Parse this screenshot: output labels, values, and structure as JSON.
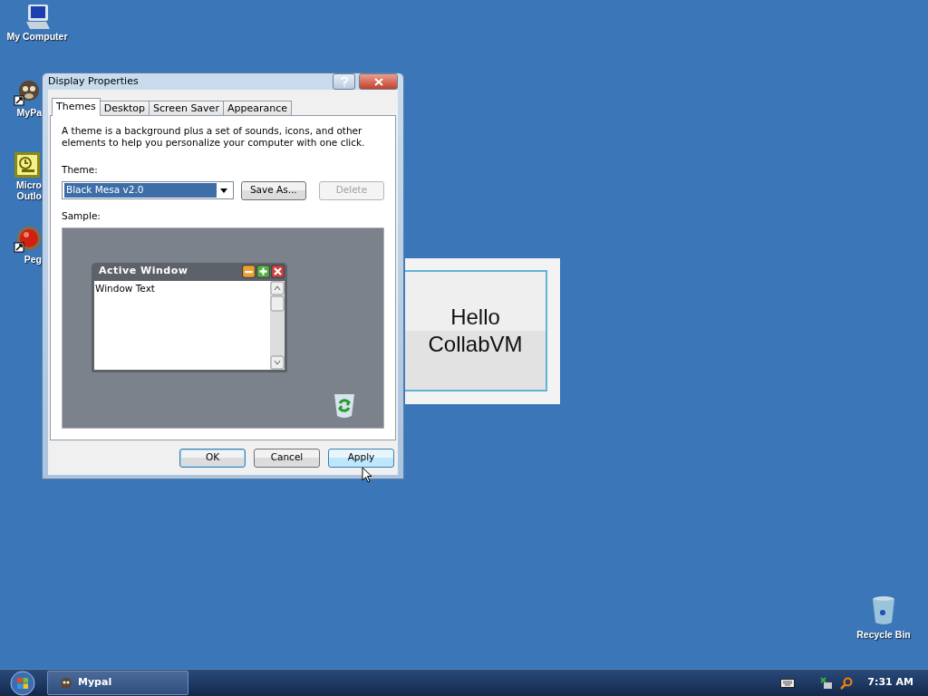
{
  "desktop_icons": [
    {
      "kind": "computer",
      "lines": [
        "My Computer"
      ]
    },
    {
      "kind": "app",
      "lines": [
        "MyPa"
      ]
    },
    {
      "kind": "mail",
      "lines": [
        "Micro",
        "Outlo"
      ]
    },
    {
      "kind": "game",
      "lines": [
        "Peg"
      ]
    }
  ],
  "recycle_bin": {
    "label": "Recycle Bin"
  },
  "hello_window": {
    "text": "Hello CollabVM"
  },
  "dialog": {
    "title": "Display Properties",
    "tabs": [
      {
        "label": "Themes",
        "selected": true
      },
      {
        "label": "Desktop",
        "selected": false
      },
      {
        "label": "Screen Saver",
        "selected": false
      },
      {
        "label": "Appearance",
        "selected": false
      }
    ],
    "description": "A theme is a background plus a set of sounds, icons, and other elements to help you personalize your computer with one click.",
    "theme_label": "Theme:",
    "theme_value": "Black Mesa v2.0",
    "theme_buttons": [
      {
        "label": "Save As...",
        "disabled": false
      },
      {
        "label": "Delete",
        "disabled": true
      }
    ],
    "sample_label": "Sample:",
    "sample": {
      "title": "Active Window",
      "body": "Window Text"
    },
    "footer_buttons": [
      {
        "label": "OK",
        "default": true,
        "hover": false
      },
      {
        "label": "Cancel",
        "default": false,
        "hover": false
      },
      {
        "label": "Apply",
        "default": false,
        "hover": true
      }
    ]
  },
  "taskbar": {
    "tasks": [
      {
        "label": "Mypal",
        "selected": false
      }
    ],
    "clock": "7:31 AM"
  }
}
